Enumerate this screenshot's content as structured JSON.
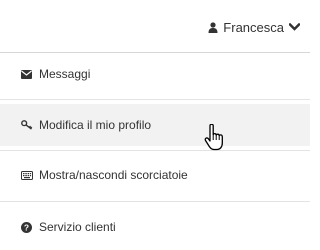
{
  "user_menu": {
    "username": "Francesca",
    "user_icon": "user-icon",
    "toggle_icon": "chevron-down-icon"
  },
  "menu": {
    "items": [
      {
        "label": "Messaggi",
        "icon": "envelope-icon"
      },
      {
        "label": "Modifica il mio profilo",
        "icon": "key-icon",
        "hovered": true
      },
      {
        "label": "Mostra/nascondi scorciatoie",
        "icon": "keyboard-icon"
      },
      {
        "label": "Servizio clienti",
        "icon": "question-circle-icon"
      }
    ]
  },
  "colors": {
    "text": "#333333",
    "hover_bg": "#f2f2f2",
    "divider": "#e3e3e3"
  },
  "cursor": {
    "type": "hand-pointer-icon"
  }
}
